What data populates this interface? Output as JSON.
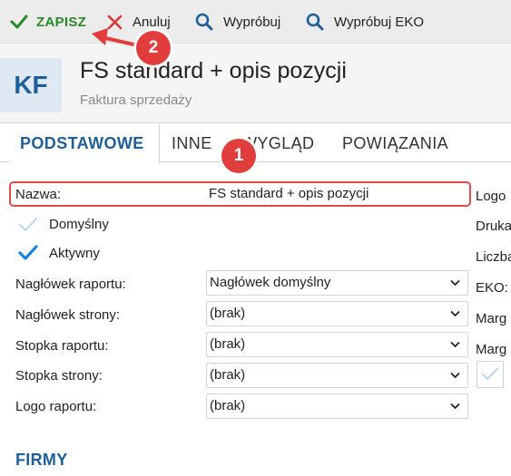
{
  "toolbar": {
    "save_label": "ZAPISZ",
    "cancel_label": "Anuluj",
    "try_label": "Wypróbuj",
    "try_eko_label": "Wypróbuj EKO"
  },
  "header": {
    "badge": "KF",
    "title": "FS standard + opis pozycji",
    "subtitle": "Faktura sprzedaży"
  },
  "tabs": [
    {
      "label": "PODSTAWOWE",
      "active": true
    },
    {
      "label": "INNE",
      "active": false
    },
    {
      "label": "WYGLĄD",
      "active": false
    },
    {
      "label": "POWIĄZANIA",
      "active": false
    }
  ],
  "form": {
    "name_label": "Nazwa:",
    "name_value": "FS standard + opis pozycji",
    "default_label": "Domyślny",
    "default_checked": false,
    "active_label": "Aktywny",
    "active_checked": true,
    "report_header_label": "Nagłówek raportu:",
    "report_header_value": "Nagłówek domyślny",
    "page_header_label": "Nagłówek strony:",
    "page_header_value": "(brak)",
    "report_footer_label": "Stopka raportu:",
    "report_footer_value": "(brak)",
    "page_footer_label": "Stopka strony:",
    "page_footer_value": "(brak)",
    "report_logo_label": "Logo raportu:",
    "report_logo_value": "(brak)"
  },
  "right_column": {
    "labels": [
      "Logo",
      "Druka",
      "Liczba",
      "EKO:",
      "Marg",
      "Marg"
    ]
  },
  "sections": {
    "firms": "FIRMY"
  },
  "annotations": {
    "marker_1": "1",
    "marker_2": "2"
  },
  "colors": {
    "accent": "#1f5f99",
    "save_green": "#2a8a2a",
    "annotation_red": "#e23d3d",
    "check_blue": "#1a86d8"
  }
}
